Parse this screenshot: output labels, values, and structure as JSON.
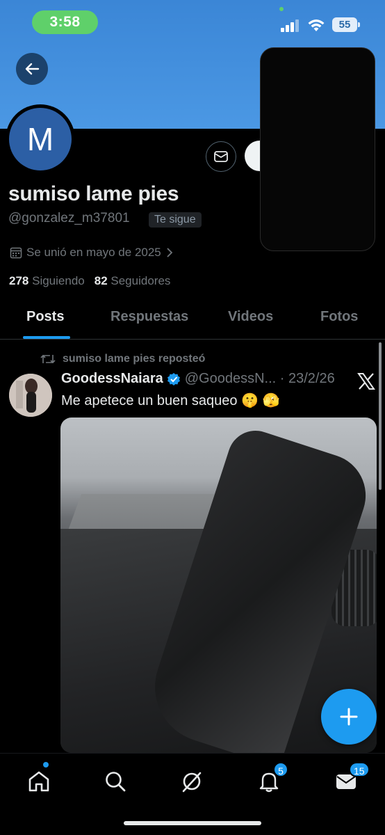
{
  "status_bar": {
    "time": "3:58",
    "battery": "55"
  },
  "profile": {
    "avatar_letter": "M",
    "display_name": "sumiso lame pies",
    "handle": "@gonzalez_m37801",
    "follows_you": "Te sigue",
    "joined": "Se unió en mayo de 2025",
    "following_count": "278",
    "following_label": "Siguiendo",
    "followers_count": "82",
    "followers_label": "Seguidores"
  },
  "tabs": [
    {
      "label": "Posts",
      "active": true
    },
    {
      "label": "Respuestas",
      "active": false
    },
    {
      "label": "Videos",
      "active": false
    },
    {
      "label": "Fotos",
      "active": false
    }
  ],
  "post": {
    "repost_label": "sumiso lame pies reposteó",
    "author": "GoodessNaiara",
    "author_handle": "@GoodessN...",
    "date": "23/2/26",
    "text": "Me apetece un buen saqueo 🤫 🫣"
  },
  "bottom_nav": {
    "notifications_badge": "5",
    "messages_badge": "15"
  },
  "colors": {
    "accent": "#1d9bf0",
    "banner": "#4b98e4",
    "avatar_bg": "#2c5fa5",
    "time_pill": "#5fd06a"
  },
  "icons": [
    "back-arrow-icon",
    "mail-icon",
    "calendar-icon",
    "chevron-right-icon",
    "repost-icon",
    "verified-icon",
    "x-logo-icon",
    "plus-icon",
    "home-icon",
    "search-icon",
    "grok-icon",
    "bell-icon",
    "envelope-icon"
  ]
}
